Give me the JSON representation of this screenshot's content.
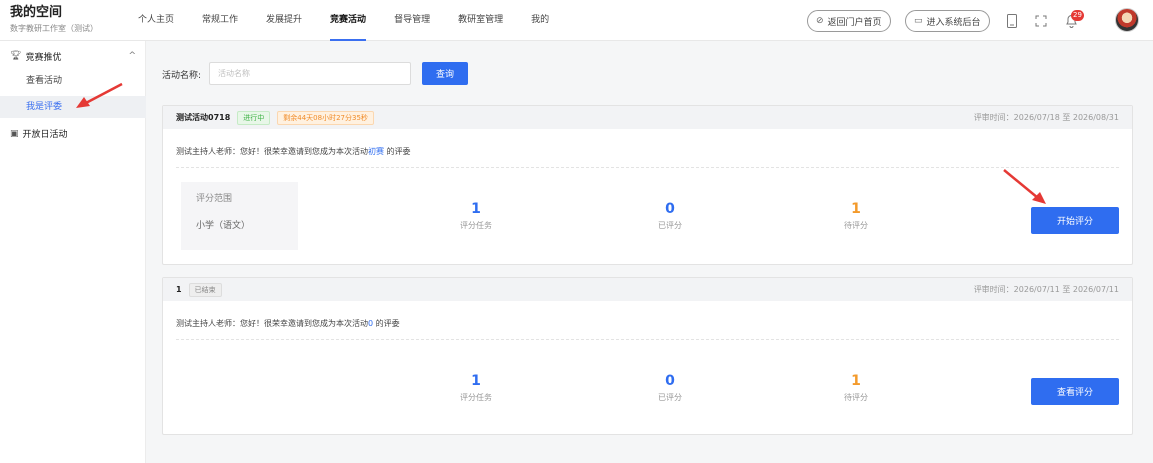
{
  "brand": {
    "title": "我的空间",
    "subtitle": "数字教研工作室（测试）"
  },
  "nav": [
    {
      "label": "个人主页"
    },
    {
      "label": "常规工作"
    },
    {
      "label": "发展提升"
    },
    {
      "label": "竞赛活动"
    },
    {
      "label": "督导管理"
    },
    {
      "label": "教研室管理"
    },
    {
      "label": "我的"
    }
  ],
  "header_actions": {
    "portal": "返回门户首页",
    "backend": "进入系统后台",
    "notification_count": "29"
  },
  "sidebar": {
    "group": "竞赛推优",
    "items": [
      {
        "label": "查看活动"
      },
      {
        "label": "我是评委"
      }
    ],
    "item2": "开放日活动"
  },
  "search": {
    "label": "活动名称:",
    "placeholder": "活动名称",
    "value": "",
    "button": "查询"
  },
  "cards": [
    {
      "title": "测试活动0718",
      "status": "进行中",
      "countdown": "剩余44天08小时27分35秒",
      "review_time": "评审时间：2026/07/18 至 2026/08/31",
      "desc_prefix": "测试主持人老师：您好！很荣幸邀请到您成为本次活动",
      "desc_highlight": "初赛",
      "desc_suffix": " 的评委",
      "scope_label": "评分范围",
      "scope_value": "小学（语文）",
      "stats": [
        {
          "num": "1",
          "label": "评分任务"
        },
        {
          "num": "0",
          "label": "已评分"
        },
        {
          "num": "1",
          "label": "待评分"
        }
      ],
      "button": "开始评分"
    },
    {
      "title": "1",
      "status": "已结束",
      "review_time": "评审时间：2026/07/11 至 2026/07/11",
      "desc_prefix": "测试主持人老师：您好！很荣幸邀请到您成为本次活动",
      "desc_highlight": "0",
      "desc_suffix": " 的评委",
      "stats": [
        {
          "num": "1",
          "label": "评分任务"
        },
        {
          "num": "0",
          "label": "已评分"
        },
        {
          "num": "1",
          "label": "待评分"
        }
      ],
      "button": "查看评分"
    }
  ],
  "colors": {
    "accent": "#2f6df0",
    "pending": "#f39a2b",
    "annotation_arrow": "#e53935"
  }
}
